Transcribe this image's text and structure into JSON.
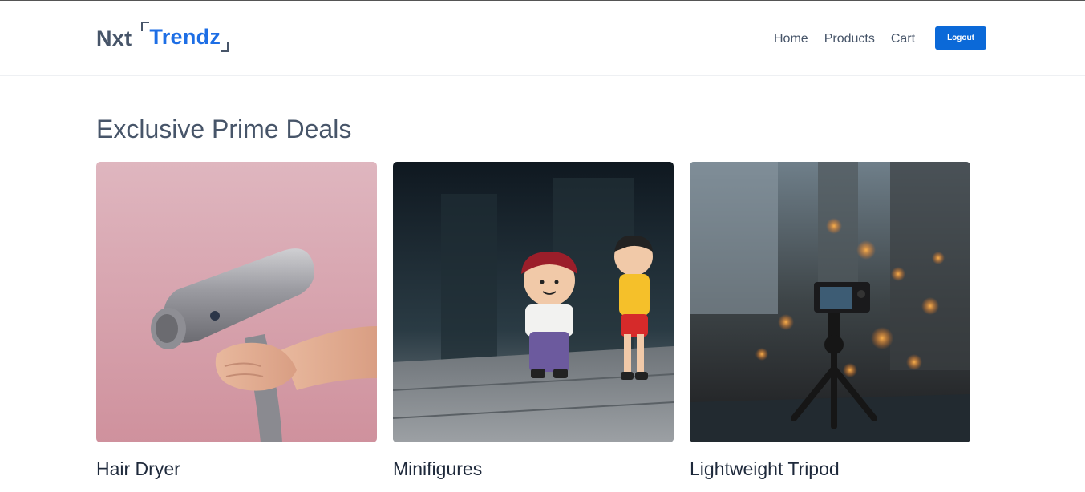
{
  "brand": {
    "part1": "Nxt",
    "part2": "Trendz",
    "part2_color": "#1d6ee5"
  },
  "nav": {
    "links": [
      "Home",
      "Products",
      "Cart"
    ],
    "logout_label": "Logout",
    "logout_color": "#0b69d8"
  },
  "main": {
    "section_title": "Exclusive Prime Deals",
    "deals": [
      {
        "title": "Hair Dryer",
        "image": "hair-dryer-image"
      },
      {
        "title": "Minifigures",
        "image": "minifigures-image"
      },
      {
        "title": "Lightweight Tripod",
        "image": "tripod-image"
      }
    ]
  }
}
